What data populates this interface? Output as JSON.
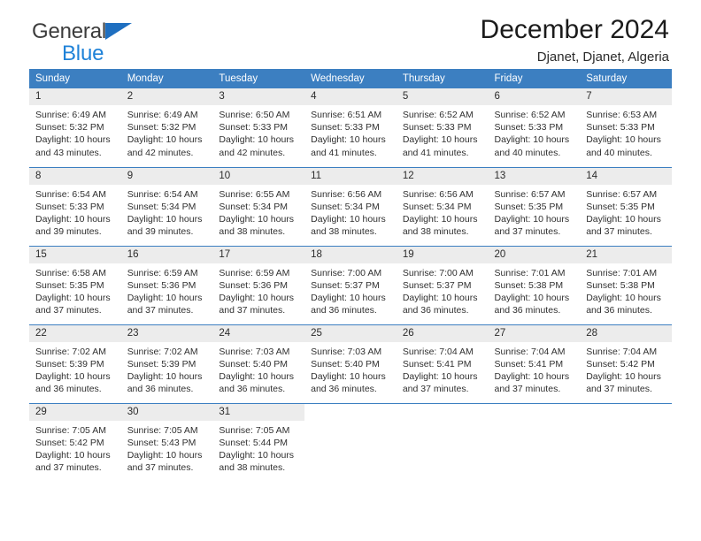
{
  "brand": {
    "line1": "General",
    "line2": "Blue",
    "triangle_icon": "blue-triangle-icon",
    "primary_color": "#1f6fc0",
    "secondary_color": "#1f82d8"
  },
  "header": {
    "title": "December 2024",
    "subtitle": "Djanet, Djanet, Algeria"
  },
  "theme": {
    "header_row_bg": "#3c7fc1",
    "header_row_text": "#ffffff",
    "daynum_bg": "#ececec",
    "divider": "#3c7fc1",
    "body_text": "#303030"
  },
  "calendar": {
    "weekday_headers": [
      "Sunday",
      "Monday",
      "Tuesday",
      "Wednesday",
      "Thursday",
      "Friday",
      "Saturday"
    ],
    "labels": {
      "sunrise": "Sunrise:",
      "sunset": "Sunset:",
      "daylight": "Daylight:"
    },
    "weeks": [
      [
        {
          "day": "1",
          "sunrise": "Sunrise: 6:49 AM",
          "sunset": "Sunset: 5:32 PM",
          "daylight_line1": "Daylight: 10 hours",
          "daylight_line2": "and 43 minutes."
        },
        {
          "day": "2",
          "sunrise": "Sunrise: 6:49 AM",
          "sunset": "Sunset: 5:32 PM",
          "daylight_line1": "Daylight: 10 hours",
          "daylight_line2": "and 42 minutes."
        },
        {
          "day": "3",
          "sunrise": "Sunrise: 6:50 AM",
          "sunset": "Sunset: 5:33 PM",
          "daylight_line1": "Daylight: 10 hours",
          "daylight_line2": "and 42 minutes."
        },
        {
          "day": "4",
          "sunrise": "Sunrise: 6:51 AM",
          "sunset": "Sunset: 5:33 PM",
          "daylight_line1": "Daylight: 10 hours",
          "daylight_line2": "and 41 minutes."
        },
        {
          "day": "5",
          "sunrise": "Sunrise: 6:52 AM",
          "sunset": "Sunset: 5:33 PM",
          "daylight_line1": "Daylight: 10 hours",
          "daylight_line2": "and 41 minutes."
        },
        {
          "day": "6",
          "sunrise": "Sunrise: 6:52 AM",
          "sunset": "Sunset: 5:33 PM",
          "daylight_line1": "Daylight: 10 hours",
          "daylight_line2": "and 40 minutes."
        },
        {
          "day": "7",
          "sunrise": "Sunrise: 6:53 AM",
          "sunset": "Sunset: 5:33 PM",
          "daylight_line1": "Daylight: 10 hours",
          "daylight_line2": "and 40 minutes."
        }
      ],
      [
        {
          "day": "8",
          "sunrise": "Sunrise: 6:54 AM",
          "sunset": "Sunset: 5:33 PM",
          "daylight_line1": "Daylight: 10 hours",
          "daylight_line2": "and 39 minutes."
        },
        {
          "day": "9",
          "sunrise": "Sunrise: 6:54 AM",
          "sunset": "Sunset: 5:34 PM",
          "daylight_line1": "Daylight: 10 hours",
          "daylight_line2": "and 39 minutes."
        },
        {
          "day": "10",
          "sunrise": "Sunrise: 6:55 AM",
          "sunset": "Sunset: 5:34 PM",
          "daylight_line1": "Daylight: 10 hours",
          "daylight_line2": "and 38 minutes."
        },
        {
          "day": "11",
          "sunrise": "Sunrise: 6:56 AM",
          "sunset": "Sunset: 5:34 PM",
          "daylight_line1": "Daylight: 10 hours",
          "daylight_line2": "and 38 minutes."
        },
        {
          "day": "12",
          "sunrise": "Sunrise: 6:56 AM",
          "sunset": "Sunset: 5:34 PM",
          "daylight_line1": "Daylight: 10 hours",
          "daylight_line2": "and 38 minutes."
        },
        {
          "day": "13",
          "sunrise": "Sunrise: 6:57 AM",
          "sunset": "Sunset: 5:35 PM",
          "daylight_line1": "Daylight: 10 hours",
          "daylight_line2": "and 37 minutes."
        },
        {
          "day": "14",
          "sunrise": "Sunrise: 6:57 AM",
          "sunset": "Sunset: 5:35 PM",
          "daylight_line1": "Daylight: 10 hours",
          "daylight_line2": "and 37 minutes."
        }
      ],
      [
        {
          "day": "15",
          "sunrise": "Sunrise: 6:58 AM",
          "sunset": "Sunset: 5:35 PM",
          "daylight_line1": "Daylight: 10 hours",
          "daylight_line2": "and 37 minutes."
        },
        {
          "day": "16",
          "sunrise": "Sunrise: 6:59 AM",
          "sunset": "Sunset: 5:36 PM",
          "daylight_line1": "Daylight: 10 hours",
          "daylight_line2": "and 37 minutes."
        },
        {
          "day": "17",
          "sunrise": "Sunrise: 6:59 AM",
          "sunset": "Sunset: 5:36 PM",
          "daylight_line1": "Daylight: 10 hours",
          "daylight_line2": "and 37 minutes."
        },
        {
          "day": "18",
          "sunrise": "Sunrise: 7:00 AM",
          "sunset": "Sunset: 5:37 PM",
          "daylight_line1": "Daylight: 10 hours",
          "daylight_line2": "and 36 minutes."
        },
        {
          "day": "19",
          "sunrise": "Sunrise: 7:00 AM",
          "sunset": "Sunset: 5:37 PM",
          "daylight_line1": "Daylight: 10 hours",
          "daylight_line2": "and 36 minutes."
        },
        {
          "day": "20",
          "sunrise": "Sunrise: 7:01 AM",
          "sunset": "Sunset: 5:38 PM",
          "daylight_line1": "Daylight: 10 hours",
          "daylight_line2": "and 36 minutes."
        },
        {
          "day": "21",
          "sunrise": "Sunrise: 7:01 AM",
          "sunset": "Sunset: 5:38 PM",
          "daylight_line1": "Daylight: 10 hours",
          "daylight_line2": "and 36 minutes."
        }
      ],
      [
        {
          "day": "22",
          "sunrise": "Sunrise: 7:02 AM",
          "sunset": "Sunset: 5:39 PM",
          "daylight_line1": "Daylight: 10 hours",
          "daylight_line2": "and 36 minutes."
        },
        {
          "day": "23",
          "sunrise": "Sunrise: 7:02 AM",
          "sunset": "Sunset: 5:39 PM",
          "daylight_line1": "Daylight: 10 hours",
          "daylight_line2": "and 36 minutes."
        },
        {
          "day": "24",
          "sunrise": "Sunrise: 7:03 AM",
          "sunset": "Sunset: 5:40 PM",
          "daylight_line1": "Daylight: 10 hours",
          "daylight_line2": "and 36 minutes."
        },
        {
          "day": "25",
          "sunrise": "Sunrise: 7:03 AM",
          "sunset": "Sunset: 5:40 PM",
          "daylight_line1": "Daylight: 10 hours",
          "daylight_line2": "and 36 minutes."
        },
        {
          "day": "26",
          "sunrise": "Sunrise: 7:04 AM",
          "sunset": "Sunset: 5:41 PM",
          "daylight_line1": "Daylight: 10 hours",
          "daylight_line2": "and 37 minutes."
        },
        {
          "day": "27",
          "sunrise": "Sunrise: 7:04 AM",
          "sunset": "Sunset: 5:41 PM",
          "daylight_line1": "Daylight: 10 hours",
          "daylight_line2": "and 37 minutes."
        },
        {
          "day": "28",
          "sunrise": "Sunrise: 7:04 AM",
          "sunset": "Sunset: 5:42 PM",
          "daylight_line1": "Daylight: 10 hours",
          "daylight_line2": "and 37 minutes."
        }
      ],
      [
        {
          "day": "29",
          "sunrise": "Sunrise: 7:05 AM",
          "sunset": "Sunset: 5:42 PM",
          "daylight_line1": "Daylight: 10 hours",
          "daylight_line2": "and 37 minutes."
        },
        {
          "day": "30",
          "sunrise": "Sunrise: 7:05 AM",
          "sunset": "Sunset: 5:43 PM",
          "daylight_line1": "Daylight: 10 hours",
          "daylight_line2": "and 37 minutes."
        },
        {
          "day": "31",
          "sunrise": "Sunrise: 7:05 AM",
          "sunset": "Sunset: 5:44 PM",
          "daylight_line1": "Daylight: 10 hours",
          "daylight_line2": "and 38 minutes."
        },
        {
          "day": "",
          "sunrise": "",
          "sunset": "",
          "daylight_line1": "",
          "daylight_line2": ""
        },
        {
          "day": "",
          "sunrise": "",
          "sunset": "",
          "daylight_line1": "",
          "daylight_line2": ""
        },
        {
          "day": "",
          "sunrise": "",
          "sunset": "",
          "daylight_line1": "",
          "daylight_line2": ""
        },
        {
          "day": "",
          "sunrise": "",
          "sunset": "",
          "daylight_line1": "",
          "daylight_line2": ""
        }
      ]
    ]
  }
}
